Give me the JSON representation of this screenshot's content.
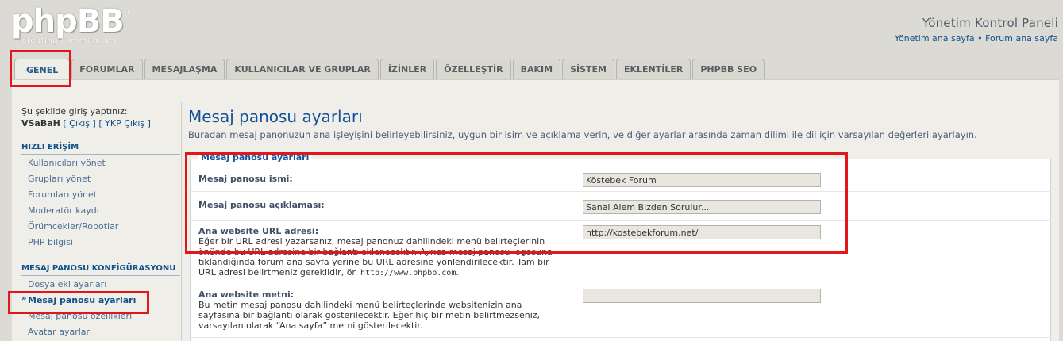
{
  "header": {
    "logo_text": "phpBB",
    "logo_tagline": "creating communities",
    "logo_reg": "®",
    "title": "Yönetim Kontrol Paneli",
    "link_home": "Yönetim ana sayfa",
    "link_sep": " • ",
    "link_forum": "Forum ana sayfa"
  },
  "tabs": [
    {
      "label": "GENEL",
      "active": true
    },
    {
      "label": "FORUMLAR"
    },
    {
      "label": "MESAJLAŞMA"
    },
    {
      "label": "KULLANICILAR VE GRUPLAR"
    },
    {
      "label": "İZİNLER"
    },
    {
      "label": "ÖZELLEŞTİR"
    },
    {
      "label": "BAKIM"
    },
    {
      "label": "SİSTEM"
    },
    {
      "label": "EKLENTİLER"
    },
    {
      "label": "PHPBB SEO"
    }
  ],
  "sidebar": {
    "login_text": "Şu şekilde giriş yaptınız:",
    "username": "VSaBaH",
    "logout_link": "[ Çıkış ]",
    "acp_logout_link": "[ YKP Çıkış ]",
    "quick_access_title": "HIZLI ERİŞİM",
    "quick_access": [
      "Kullanıcıları yönet",
      "Grupları yönet",
      "Forumları yönet",
      "Moderatör kaydı",
      "Örümcekler/Robotlar",
      "PHP bilgisi"
    ],
    "config_title": "MESAJ PANOSU KONFİGÜRASYONU",
    "config_items": [
      "Dosya eki ayarları",
      "Mesaj panosu ayarları",
      "Mesaj panosu özellikleri",
      "Avatar ayarları"
    ]
  },
  "main": {
    "title": "Mesaj panosu ayarları",
    "description": "Buradan mesaj panonuzun ana işleyişini belirleyebilirsiniz, uygun bir isim ve açıklama verin, ve diğer ayarlar arasında zaman dilimi ile dil için varsayılan değerleri ayarlayın.",
    "legend": "Mesaj panosu ayarları",
    "fields": {
      "sitename": {
        "label": "Mesaj panosu ismi:",
        "value": "Köstebek Forum"
      },
      "site_desc": {
        "label": "Mesaj panosu açıklaması:",
        "value": "Sanal Alem Bizden Sorulur..."
      },
      "site_home_url": {
        "label": "Ana website URL adresi:",
        "explain": "Eğer bir URL adresi yazarsanız, mesaj panonuz dahilindeki menü belirteçlerinin önünde bu URL adresine bir bağlantı eklenecektir. Ayrıca mesaj panosu logosuna tıklandığında forum ana sayfa yerine bu URL adresine yönlendirilecektir. Tam bir URL adresi belirtmeniz gereklidir, ör.",
        "example": "http://www.phpbb.com",
        "example_suffix": ".",
        "value": "http://kostebekforum.net/"
      },
      "site_home_text": {
        "label": "Ana website metni:",
        "explain": "Bu metin mesaj panosu dahilindeki menü belirteçlerinde websitenizin ana sayfasına bir bağlantı olarak gösterilecektir. Eğer hiç bir metin belirtmezseniz, varsayılan olarak “Ana sayfa” metni gösterilecektir.",
        "value": ""
      }
    }
  },
  "colors": {
    "accent": "#105289",
    "highlight": "#e0181c",
    "background": "#dcdad5"
  }
}
